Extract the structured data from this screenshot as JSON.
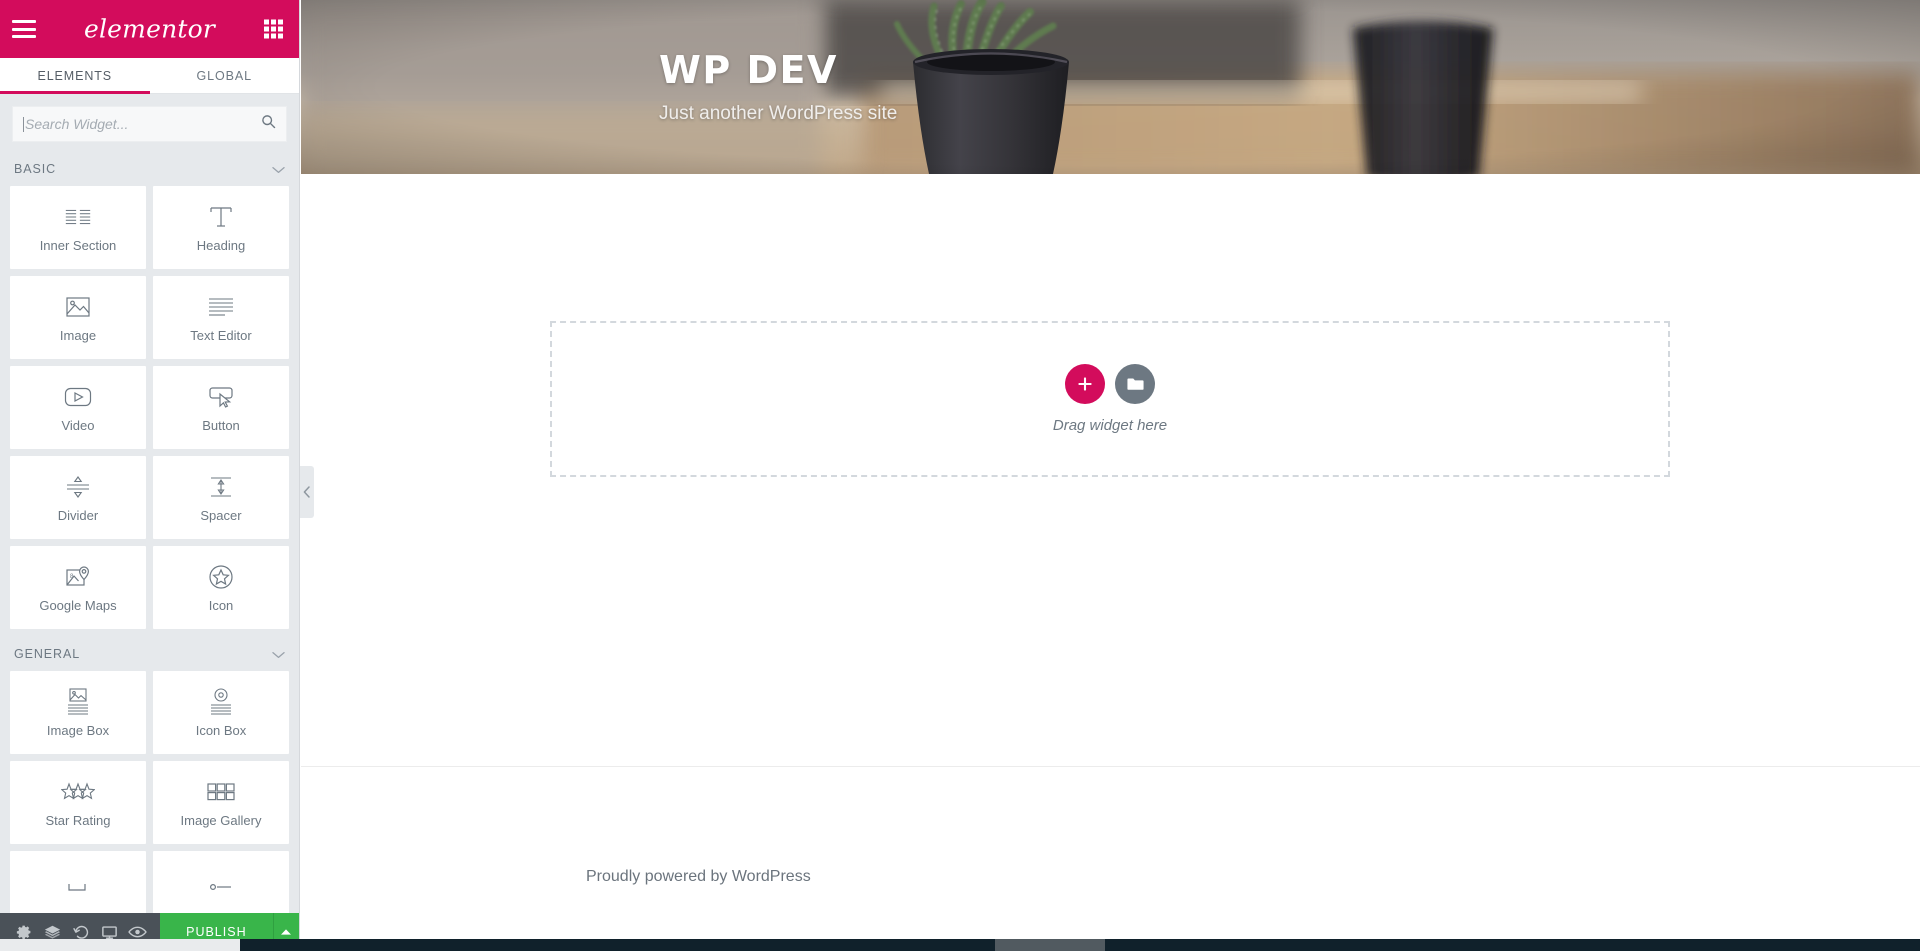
{
  "app": {
    "brand": "elementor",
    "menu_icon": "hamburger-icon",
    "apps_icon": "apps-grid-icon"
  },
  "panel": {
    "tabs": [
      {
        "label": "ELEMENTS",
        "active": true
      },
      {
        "label": "GLOBAL",
        "active": false
      }
    ],
    "search": {
      "placeholder": "Search Widget...",
      "value": "",
      "icon": "search-icon"
    },
    "sections": [
      {
        "title": "BASIC",
        "collapse_icon": "chevron-down-icon",
        "widgets": [
          {
            "label": "Inner Section",
            "icon": "inner-section-icon"
          },
          {
            "label": "Heading",
            "icon": "heading-t-icon"
          },
          {
            "label": "Image",
            "icon": "image-icon"
          },
          {
            "label": "Text Editor",
            "icon": "text-editor-icon"
          },
          {
            "label": "Video",
            "icon": "video-play-icon"
          },
          {
            "label": "Button",
            "icon": "button-cursor-icon"
          },
          {
            "label": "Divider",
            "icon": "divider-icon"
          },
          {
            "label": "Spacer",
            "icon": "spacer-icon"
          },
          {
            "label": "Google Maps",
            "icon": "google-maps-pin-icon"
          },
          {
            "label": "Icon",
            "icon": "star-circle-icon"
          }
        ]
      },
      {
        "title": "GENERAL",
        "collapse_icon": "chevron-down-icon",
        "widgets": [
          {
            "label": "Image Box",
            "icon": "image-box-icon"
          },
          {
            "label": "Icon Box",
            "icon": "icon-box-icon"
          },
          {
            "label": "Star Rating",
            "icon": "star-rating-icon"
          },
          {
            "label": "Image Gallery",
            "icon": "image-gallery-icon"
          }
        ]
      }
    ],
    "footer": {
      "tools": [
        {
          "name": "settings-gear-icon",
          "label": "Settings"
        },
        {
          "name": "navigator-layers-icon",
          "label": "Navigator"
        },
        {
          "name": "history-revert-icon",
          "label": "History"
        },
        {
          "name": "responsive-monitor-icon",
          "label": "Responsive Mode"
        },
        {
          "name": "preview-eye-icon",
          "label": "Preview Changes"
        }
      ],
      "publish_label": "PUBLISH",
      "publish_caret_icon": "caret-up-icon",
      "publish_color": "#39b54a"
    },
    "collapse_handle_icon": "chevron-left-icon"
  },
  "canvas": {
    "hero": {
      "site_title": "WP DEV",
      "tagline": "Just another WordPress site",
      "background_image": "potted-snake-plant-photo"
    },
    "dropzone": {
      "add_section_icon": "plus-icon",
      "add_template_icon": "folder-icon",
      "hint": "Drag widget here"
    },
    "footer": {
      "credit": "Proudly powered by WordPress"
    }
  },
  "colors": {
    "brand_magenta": "#d30c5c",
    "panel_bg": "#e6e9ec",
    "toolbar_bg": "#4a5158",
    "publish_green": "#39b54a",
    "muted_text": "#6d7882"
  }
}
